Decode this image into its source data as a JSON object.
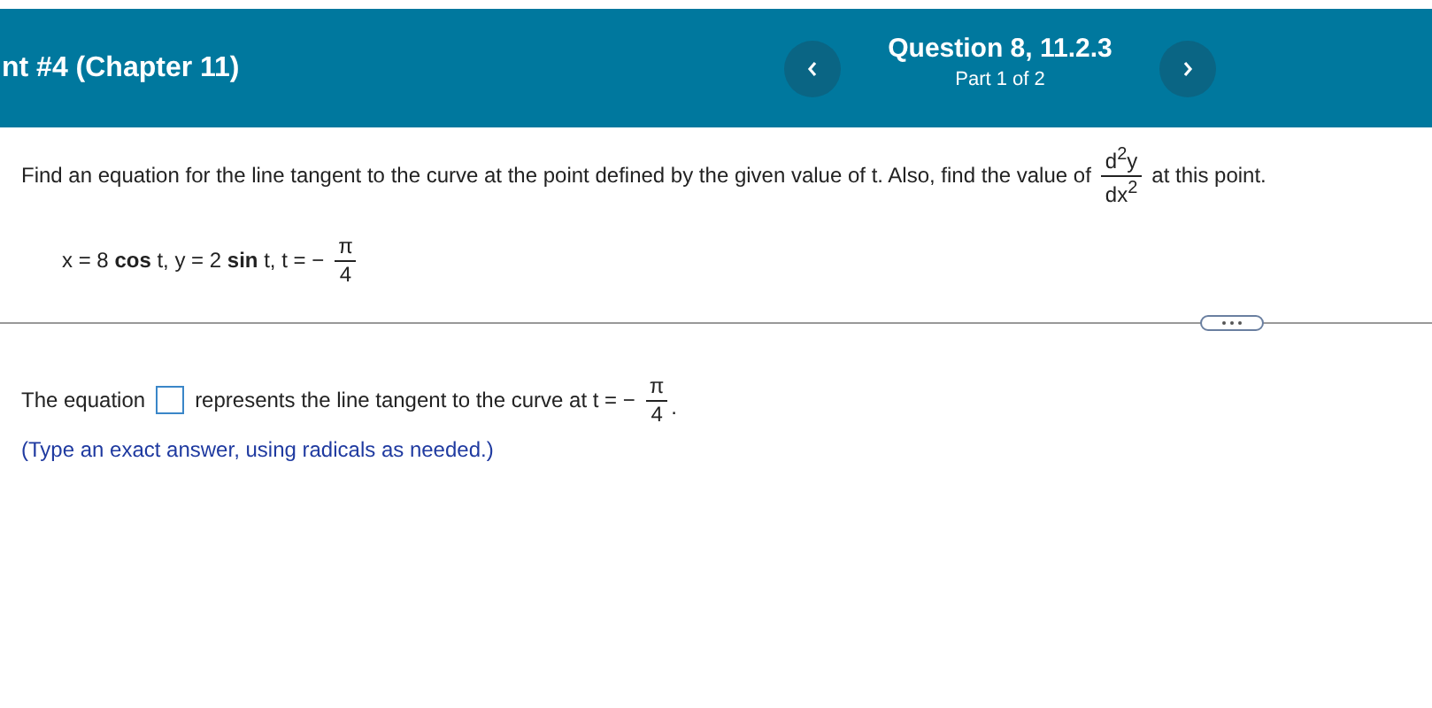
{
  "header": {
    "title": "nt #4 (Chapter 11)",
    "question": "Question 8, 11.2.3",
    "part": "Part 1 of 2"
  },
  "question": {
    "before": "Find an equation for the line tangent to the curve at the point defined by the given value of t. Also, find the value of",
    "fraction": {
      "numerator": "d$^{2}$y",
      "denominator": "dx$^{2}$"
    },
    "after": "at this point."
  },
  "given": {
    "text": "x = 8 **cos** t, y = 2 **sin** t, t = −",
    "fraction": {
      "numerator": "π",
      "denominator": "4"
    }
  },
  "answer": {
    "before": "The equation",
    "after": "represents the line tangent to the curve at t = −",
    "fraction": {
      "numerator": "π",
      "denominator": "4"
    },
    "end": "."
  },
  "hint": "(Type an exact answer, using radicals as needed.)"
}
